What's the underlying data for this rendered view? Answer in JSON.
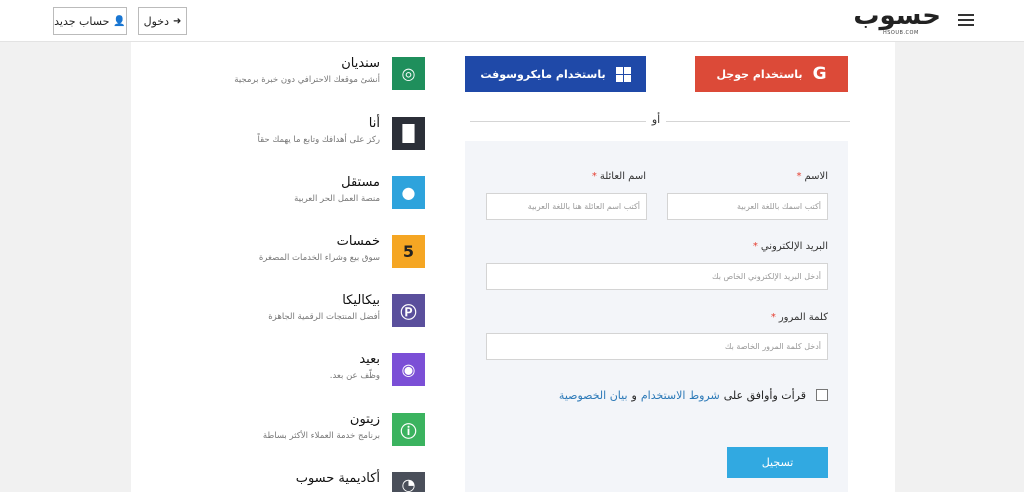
{
  "header": {
    "logo_text": "حسوب",
    "logo_sub": "HSOUB.COM",
    "login_label": "دخول",
    "register_label": "حساب جديد"
  },
  "auth": {
    "google_label": "باستخدام جوجل",
    "google_icon": "google-g-icon",
    "microsoft_label": "باستخدام مايكروسوفت",
    "microsoft_icon": "windows-logo-icon",
    "or_label": "أو",
    "google_color": "#dc4a38",
    "microsoft_color": "#1f49a8"
  },
  "form": {
    "first_name_label": "الاسم",
    "first_name_placeholder": "أكتب اسمك باللغة العربية",
    "last_name_label": "اسم العائلة",
    "last_name_placeholder": "أكتب اسم العائلة هنا باللغة العربية",
    "email_label": "البريد الإلكتروني",
    "email_placeholder": "أدخل البريد الإلكتروني الخاص بك",
    "password_label": "كلمة المرور",
    "password_placeholder": "أدخل كلمة المرور الخاصة بك",
    "required_mark": "*",
    "agree_prefix": "قرأت وأوافق على",
    "terms_link": "شروط الاستخدام",
    "and_word": "و",
    "privacy_link": "بيان الخصوصية",
    "submit_label": "تسجيل",
    "submit_color": "#31a9e1"
  },
  "products": [
    {
      "name": "سنديان",
      "desc": "أنشئ موقعك الاحترافي دون خبرة برمجية",
      "color": "#1f8f5c",
      "icon": "sindyan-icon"
    },
    {
      "name": "أنا",
      "desc": "ركز على أهدافك وتابع ما يهمك حقاً",
      "color": "#2b2f38",
      "icon": "ana-icon"
    },
    {
      "name": "مستقل",
      "desc": "منصة العمل الحر العربية",
      "color": "#2ea3dc",
      "icon": "mostaql-icon"
    },
    {
      "name": "خمسات",
      "desc": "سوق بيع وشراء الخدمات المصغرة",
      "color": "#f5a623",
      "icon": "khamsat-icon"
    },
    {
      "name": "بيكاليكا",
      "desc": "أفضل المنتجات الرقمية الجاهزة",
      "color": "#5a4f9c",
      "icon": "picalica-icon"
    },
    {
      "name": "بعيد",
      "desc": "وظّف عن بعد.",
      "color": "#7b4fd6",
      "icon": "baaeed-icon"
    },
    {
      "name": "زيتون",
      "desc": "برنامج خدمة العملاء الأكثر بساطة",
      "color": "#3bb35f",
      "icon": "zeitoon-icon"
    },
    {
      "name": "أكاديمية حسوب",
      "desc": "",
      "color": "#4a4f5a",
      "icon": "academy-icon"
    }
  ]
}
